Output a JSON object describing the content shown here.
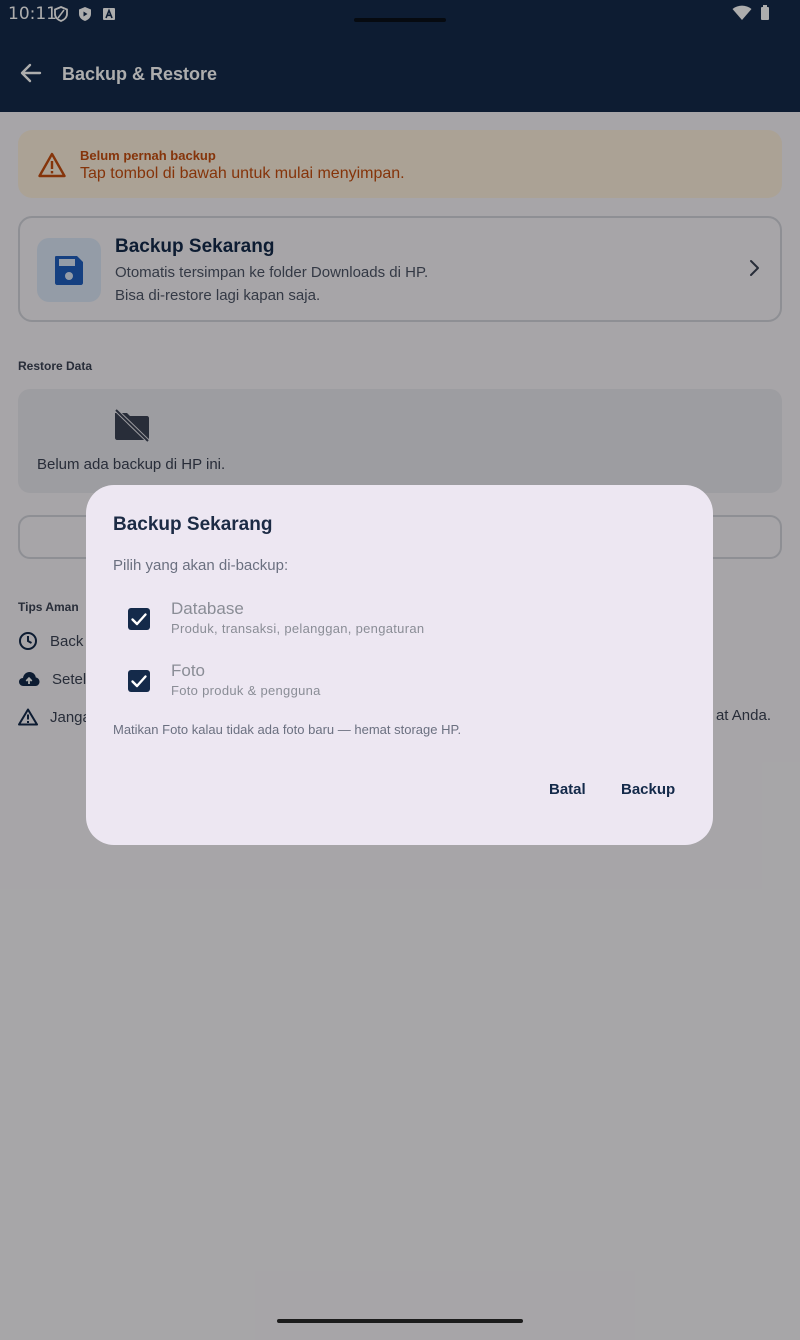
{
  "status_bar": {
    "time": "10:11"
  },
  "app_bar": {
    "title": "Backup & Restore"
  },
  "warning": {
    "title": "Belum pernah backup",
    "text": "Tap tombol di bawah untuk mulai menyimpan."
  },
  "backup_card": {
    "title": "Backup Sekarang",
    "line1": "Otomatis tersimpan ke folder Downloads di HP.",
    "line2": "Bisa di-restore lagi kapan saja."
  },
  "restore": {
    "label": "Restore Data",
    "empty_text": "Belum ada backup di HP ini."
  },
  "tips": {
    "label": "Tips Aman",
    "items": [
      {
        "text": "Back",
        "icon": "clock-icon"
      },
      {
        "text": "Setel",
        "icon": "cloud-upload-icon"
      },
      {
        "text": "Janga",
        "icon": "warning-icon",
        "end_text": "at Anda."
      }
    ]
  },
  "dialog": {
    "title": "Backup Sekarang",
    "subtitle": "Pilih yang akan di-backup:",
    "options": [
      {
        "label": "Database",
        "desc": "Produk, transaksi, pelanggan, pengaturan",
        "checked": true
      },
      {
        "label": "Foto",
        "desc": "Foto produk & pengguna",
        "checked": true
      }
    ],
    "note": "Matikan Foto kalau tidak ada foto baru — hemat storage HP.",
    "cancel_label": "Batal",
    "confirm_label": "Backup"
  },
  "colors": {
    "primary": "#142a4a",
    "warning": "#c44d0f",
    "warning_bg": "#fcefdc",
    "dialog_bg": "#ede7f2"
  }
}
